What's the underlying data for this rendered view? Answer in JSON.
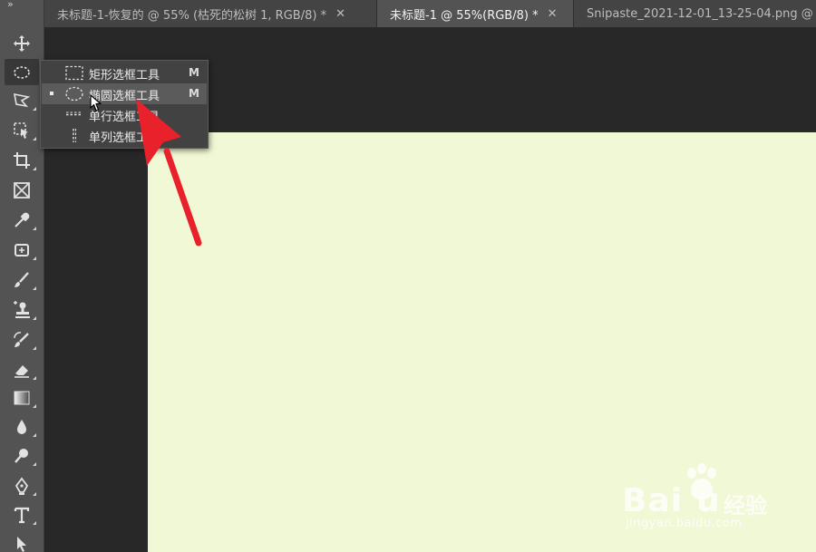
{
  "tabs": [
    {
      "title": "未标题-1-恢复的 @ 55% (枯死的松树 1, RGB/8) *",
      "close": "✕"
    },
    {
      "title": "未标题-1 @ 55%(RGB/8) *",
      "close": "✕"
    },
    {
      "title": "Snipaste_2021-12-01_13-25-04.png @",
      "close": ""
    }
  ],
  "toolbar": {
    "grip": "»",
    "tools": [
      "move-tool",
      "elliptical-marquee-tool",
      "lasso-tool",
      "object-selection-tool",
      "crop-tool",
      "frame-tool",
      "eyedropper-tool",
      "spot-healing-tool",
      "brush-tool",
      "clone-stamp-tool",
      "history-brush-tool",
      "eraser-tool",
      "gradient-tool",
      "blur-tool",
      "dodge-tool",
      "pen-tool",
      "type-tool",
      "path-selection-tool"
    ]
  },
  "flyout": {
    "items": [
      {
        "label": "矩形选框工具",
        "shortcut": "M",
        "icon": "rectangular-marquee-icon"
      },
      {
        "label": "椭圆选框工具",
        "shortcut": "M",
        "icon": "elliptical-marquee-icon"
      },
      {
        "label": "单行选框工具",
        "shortcut": "",
        "icon": "single-row-marquee-icon"
      },
      {
        "label": "单列选框工具",
        "shortcut": "",
        "icon": "single-column-marquee-icon"
      }
    ]
  },
  "colors": {
    "canvas": "#f1f8d6",
    "arrow": "#e8212b",
    "panel": "#535353"
  },
  "watermark": {
    "brand": "Bai",
    "brand2": "u",
    "cn": "经验",
    "url": "jingyan.baidu.com"
  }
}
